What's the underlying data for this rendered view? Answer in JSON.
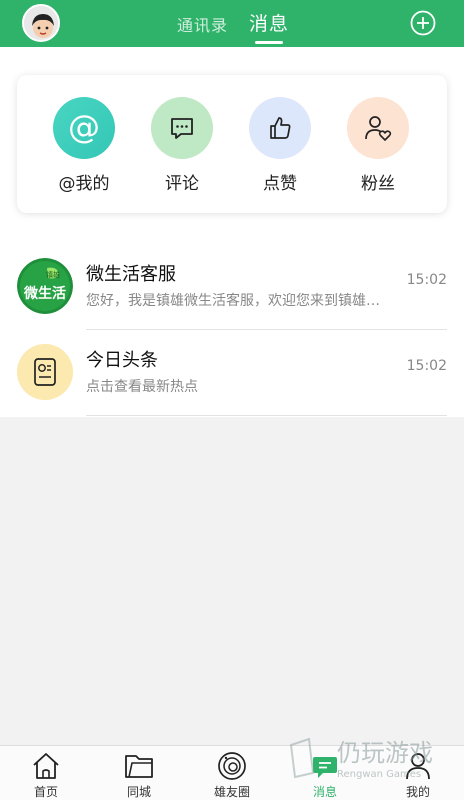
{
  "header": {
    "tab_contacts": "通讯录",
    "tab_messages": "消息"
  },
  "quick_actions": [
    {
      "label": "@我的",
      "icon": "at-icon",
      "color": "#3fd0bd"
    },
    {
      "label": "评论",
      "icon": "comment-icon",
      "color": "#bfe8c4"
    },
    {
      "label": "点赞",
      "icon": "thumbs-up-icon",
      "color": "#dde7fb"
    },
    {
      "label": "粉丝",
      "icon": "fans-icon",
      "color": "#fde3d2"
    }
  ],
  "messages": [
    {
      "title": "微生活客服",
      "preview": "您好，我是镇雄微生活客服，欢迎您来到镇雄…",
      "time": "15:02",
      "avatar_text": "微生活",
      "avatar_badge": "镇雄"
    },
    {
      "title": "今日头条",
      "preview": "点击查看最新热点",
      "time": "15:02"
    }
  ],
  "bottom_nav": [
    {
      "label": "首页",
      "icon": "home-icon"
    },
    {
      "label": "同城",
      "icon": "folder-icon"
    },
    {
      "label": "雄友圈",
      "icon": "planet-icon"
    },
    {
      "label": "消息",
      "icon": "message-icon",
      "active": true
    },
    {
      "label": "我的",
      "icon": "user-icon"
    }
  ],
  "watermark": {
    "main": "仍玩游戏",
    "sub": "Rengwan Games"
  },
  "colors": {
    "brand": "#2fb36a"
  }
}
